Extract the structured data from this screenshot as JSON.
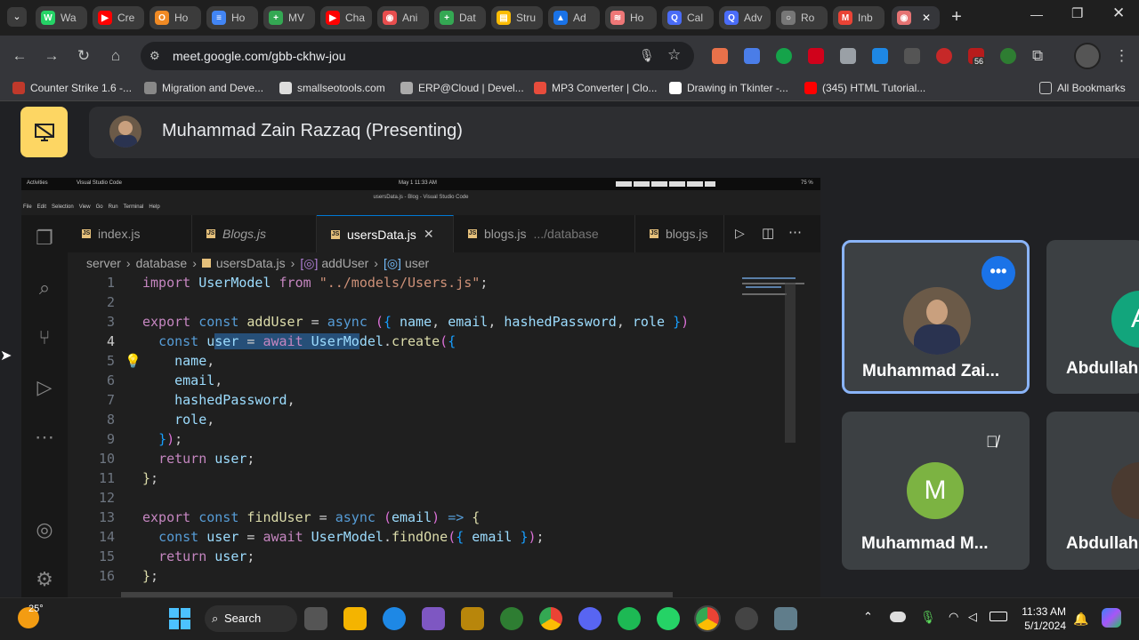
{
  "browser": {
    "tabs": [
      {
        "label": "Wa",
        "color": "#25d366",
        "glyph": "W"
      },
      {
        "label": "Cre",
        "color": "#ff0000",
        "glyph": "▶"
      },
      {
        "label": "Ho",
        "color": "#f08a24",
        "glyph": "O"
      },
      {
        "label": "Ho",
        "color": "#4285f4",
        "glyph": "≡"
      },
      {
        "label": "MV",
        "color": "#34a853",
        "glyph": "+"
      },
      {
        "label": "Cha",
        "color": "#ff0000",
        "glyph": "▶"
      },
      {
        "label": "Ani",
        "color": "#e84e4e",
        "glyph": "◉"
      },
      {
        "label": "Dat",
        "color": "#34a853",
        "glyph": "+"
      },
      {
        "label": "Stru",
        "color": "#fbbc04",
        "glyph": "▤"
      },
      {
        "label": "Ad",
        "color": "#1a73e8",
        "glyph": "▲"
      },
      {
        "label": "Ho",
        "color": "#e77",
        "glyph": "≋"
      },
      {
        "label": "Cal",
        "color": "#4a6cf7",
        "glyph": "Q"
      },
      {
        "label": "Adv",
        "color": "#4a6cf7",
        "glyph": "Q"
      },
      {
        "label": "Ro",
        "color": "#777",
        "glyph": "○"
      },
      {
        "label": "Inb",
        "color": "#ea4335",
        "glyph": "M"
      },
      {
        "label": "",
        "color": "#e57373",
        "glyph": "◉"
      }
    ],
    "url": "meet.google.com/gbb-ckhw-jou",
    "ext_badge": "56",
    "bookmarks": [
      {
        "label": "Counter Strike 1.6 -...",
        "color": "#c0392b"
      },
      {
        "label": "Migration and Deve...",
        "color": "#888"
      },
      {
        "label": "smallseotools.com",
        "color": "#ddd"
      },
      {
        "label": "ERP@Cloud | Devel...",
        "color": "#aaa"
      },
      {
        "label": "MP3 Converter | Clo...",
        "color": "#e74c3c"
      },
      {
        "label": "Drawing in Tkinter -...",
        "color": "#fff"
      },
      {
        "label": "(345) HTML Tutorial...",
        "color": "#ff0000"
      }
    ],
    "all_bookmarks": "All Bookmarks"
  },
  "meet": {
    "presenter": "Muhammad Zain Razzaq (Presenting)",
    "tiles": [
      {
        "name": "Muhammad Zai..."
      },
      {
        "name": "Abdullah",
        "initial": "A"
      },
      {
        "name": "Muhammad M...",
        "initial": "M"
      },
      {
        "name": "Abdullah"
      }
    ]
  },
  "vscode": {
    "ubuntu_activities": "Activities",
    "ubuntu_app": "Visual Studio Code",
    "ubuntu_clock": "May 1  11:33 AM",
    "ubuntu_battery": "75 %",
    "window_title": "usersData.js - Blog - Visual Studio Code",
    "menu": [
      "File",
      "Edit",
      "Selection",
      "View",
      "Go",
      "Run",
      "Terminal",
      "Help"
    ],
    "tabs": [
      {
        "label": "index.js"
      },
      {
        "label": "Blogs.js"
      },
      {
        "label": "usersData.js"
      },
      {
        "label": "blogs.js",
        "hint": ".../database"
      },
      {
        "label": "blogs.js"
      }
    ],
    "breadcrumb": [
      "server",
      "database",
      "usersData.js",
      "addUser",
      "user"
    ]
  },
  "taskbar": {
    "weather": "25°",
    "search": "Search",
    "time": "11:33 AM",
    "date": "5/1/2024"
  }
}
